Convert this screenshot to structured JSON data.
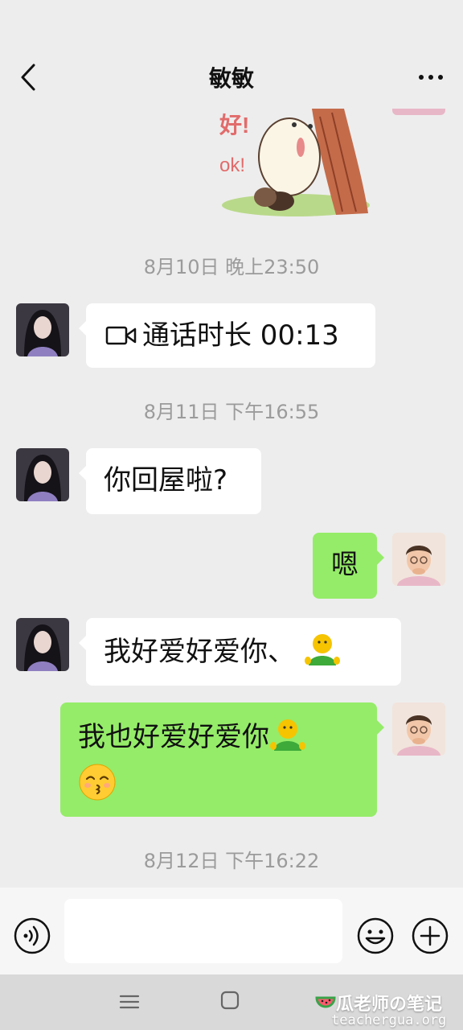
{
  "header": {
    "title": "敏敏"
  },
  "messages": {
    "ts1": "8月10日 晚上23:50",
    "call_text": "通话时长 00:13",
    "ts2": "8月11日 下午16:55",
    "m1": "你回屋啦?",
    "m2": "嗯",
    "m3": "我好爱好爱你、",
    "m4": "我也好爱好爱你",
    "ts3": "8月12日 下午16:22"
  },
  "sticker": {
    "text_top": "好!",
    "text_bottom": "ok!"
  },
  "watermark": {
    "title": "瓜老师の笔记",
    "url": "teachergua.org"
  },
  "icons": [
    "back-icon",
    "more-icon",
    "video-call-icon",
    "voice-icon",
    "emoji-icon",
    "plus-icon",
    "menu-icon",
    "home-icon",
    "watermelon-icon"
  ],
  "colors": {
    "background": "#ededed",
    "outgoing_bubble": "#95ec69",
    "incoming_bubble": "#ffffff"
  }
}
